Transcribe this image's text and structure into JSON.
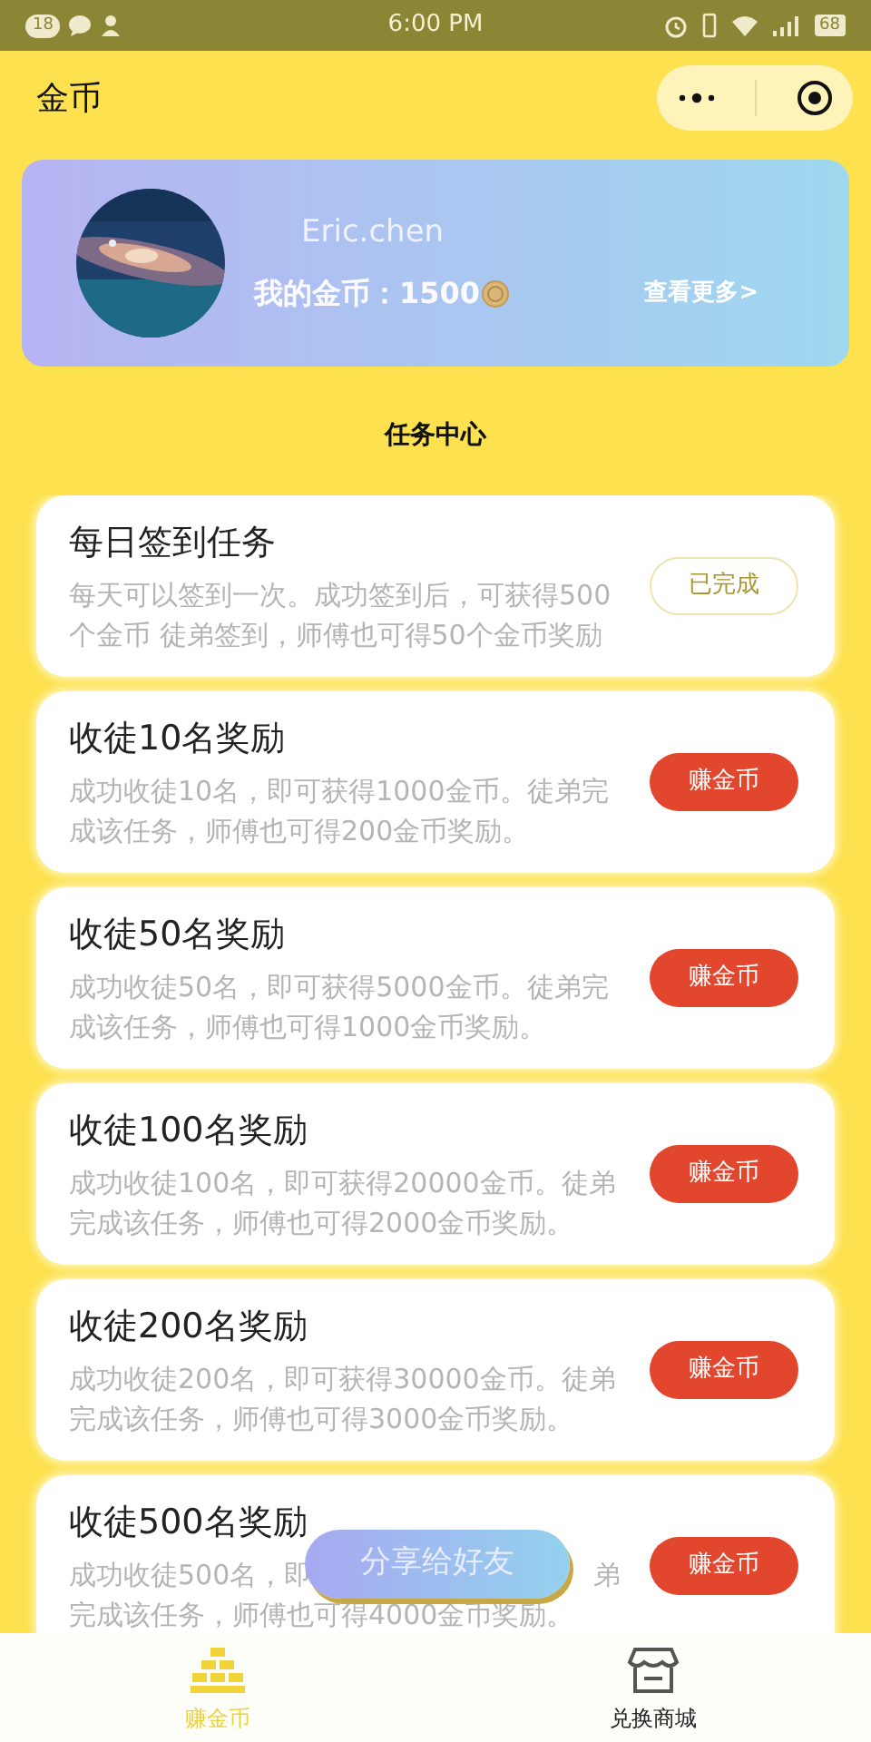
{
  "status_bar": {
    "notification_count": "18",
    "time": "6:00 PM",
    "battery": "68"
  },
  "nav": {
    "title": "金币"
  },
  "profile": {
    "name": "Eric.chen",
    "coins_label": "我的金币：",
    "coins": "1500",
    "more_link": "查看更多>"
  },
  "section_title": "任务中心",
  "tasks": [
    {
      "kind": "full",
      "title": "每日签到任务",
      "description": "每天可以签到一次。成功签到后，可获得500个金币 徒弟签到，师傅也可得50个金币奖励",
      "button": "已完成",
      "completed": true
    },
    {
      "kind": "full",
      "title": "收徒10名奖励",
      "description": "成功收徒10名，即可获得1000金币。徒弟完成该任务，师傅也可得200金币奖励。",
      "button": "赚金币",
      "completed": false
    },
    {
      "kind": "full",
      "title": "收徒50名奖励",
      "description": "成功收徒50名，即可获得5000金币。徒弟完成该任务，师傅也可得1000金币奖励。",
      "button": "赚金币",
      "completed": false
    },
    {
      "kind": "full",
      "title": "收徒100名奖励",
      "description": "成功收徒100名，即可获得20000金币。徒弟完成该任务，师傅也可得2000金币奖励。",
      "button": "赚金币",
      "completed": false
    },
    {
      "kind": "full",
      "title": "收徒200名奖励",
      "description": "成功收徒200名，即可获得30000金币。徒弟完成该任务，师傅也可得3000金币奖励。",
      "button": "赚金币",
      "completed": false
    },
    {
      "kind": "covered",
      "title": "收徒500名奖励",
      "description_start": "成功收徒500名，即",
      "description_end": "弟",
      "description_line_2": "完成该任务，师傅也可得4000金币奖励。",
      "button": "赚金币",
      "completed": false
    }
  ],
  "share_button": "分享给好友",
  "tab_bar": [
    {
      "label": "赚金币",
      "selected": true,
      "kind": "gold"
    },
    {
      "label": "兑换商城",
      "selected": false,
      "kind": "store"
    }
  ]
}
